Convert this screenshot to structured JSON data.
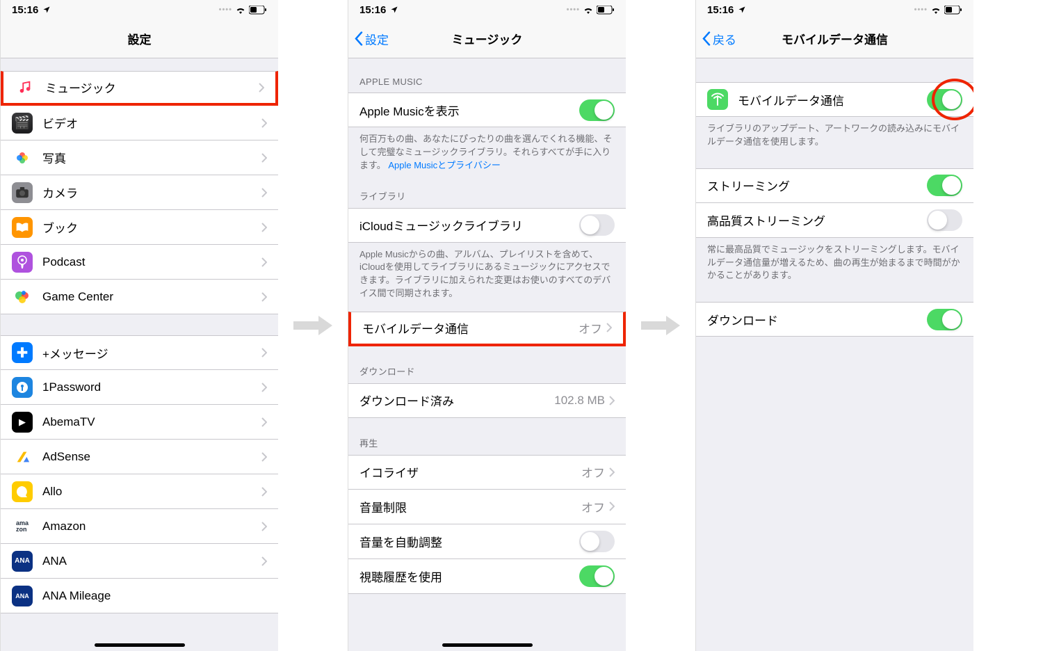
{
  "status": {
    "time": "15:16"
  },
  "screen1": {
    "nav_title": "設定",
    "rows_group1": [
      {
        "label": "ミュージック",
        "icon_bg": "#fff",
        "icon_fg": "linear-gradient(#ff2d55,#ff2d55)",
        "id": "music",
        "highlighted": true
      },
      {
        "label": "ビデオ",
        "icon_bg": "#fff",
        "id": "videos"
      },
      {
        "label": "写真",
        "icon_bg": "#fff",
        "id": "photos"
      },
      {
        "label": "カメラ",
        "icon_bg": "#8e8e93",
        "id": "camera"
      },
      {
        "label": "ブック",
        "icon_bg": "#ff9500",
        "id": "books"
      },
      {
        "label": "Podcast",
        "icon_bg": "#af52de",
        "id": "podcast"
      },
      {
        "label": "Game Center",
        "icon_bg": "#fff",
        "id": "gamecenter"
      }
    ],
    "rows_group2": [
      {
        "label": "+メッセージ",
        "icon_bg": "#007aff",
        "id": "plusmessage"
      },
      {
        "label": "1Password",
        "icon_bg": "#1d85e0",
        "id": "1password"
      },
      {
        "label": "AbemaTV",
        "icon_bg": "#000",
        "id": "abematv"
      },
      {
        "label": "AdSense",
        "icon_bg": "#fff",
        "id": "adsense"
      },
      {
        "label": "Allo",
        "icon_bg": "#ffcc00",
        "id": "allo"
      },
      {
        "label": "Amazon",
        "icon_bg": "#fff",
        "id": "amazon"
      },
      {
        "label": "ANA",
        "icon_bg": "#0b3183",
        "id": "ana"
      },
      {
        "label": "ANA Mileage",
        "icon_bg": "#0b3183",
        "id": "anamileage"
      }
    ]
  },
  "screen2": {
    "nav_back": "設定",
    "nav_title": "ミュージック",
    "section_apple_music": "APPLE MUSIC",
    "row_show_apple_music": "Apple Musicを表示",
    "footer_apple_music_1": "何百万もの曲、あなたにぴったりの曲を選んでくれる機能、そして完璧なミュージックライブラリ。それらすべてが手に入ります。",
    "footer_apple_music_link": "Apple Musicとプライバシー",
    "section_library": "ライブラリ",
    "row_icloud_library": "iCloudミュージックライブラリ",
    "footer_icloud": "Apple Musicからの曲、アルバム、プレイリストを含めて、iCloudを使用してライブラリにあるミュージックにアクセスできます。ライブラリに加えられた変更はお使いのすべてのデバイス間で同期されます。",
    "row_mobile_data": "モバイルデータ通信",
    "row_mobile_data_value": "オフ",
    "section_download": "ダウンロード",
    "row_downloaded": "ダウンロード済み",
    "row_downloaded_value": "102.8 MB",
    "section_playback": "再生",
    "row_eq": "イコライザ",
    "row_eq_value": "オフ",
    "row_volume_limit": "音量制限",
    "row_volume_limit_value": "オフ",
    "row_sound_check": "音量を自動調整",
    "row_history": "視聴履歴を使用"
  },
  "screen3": {
    "nav_back": "戻る",
    "nav_title": "モバイルデータ通信",
    "row_mobile_data": "モバイルデータ通信",
    "footer_mobile_data": "ライブラリのアップデート、アートワークの読み込みにモバイルデータ通信を使用します。",
    "row_streaming": "ストリーミング",
    "row_hq_streaming": "高品質ストリーミング",
    "footer_hq": "常に最高品質でミュージックをストリーミングします。モバイルデータ通信量が増えるため、曲の再生が始まるまで時間がかかることがあります。",
    "row_download": "ダウンロード"
  }
}
